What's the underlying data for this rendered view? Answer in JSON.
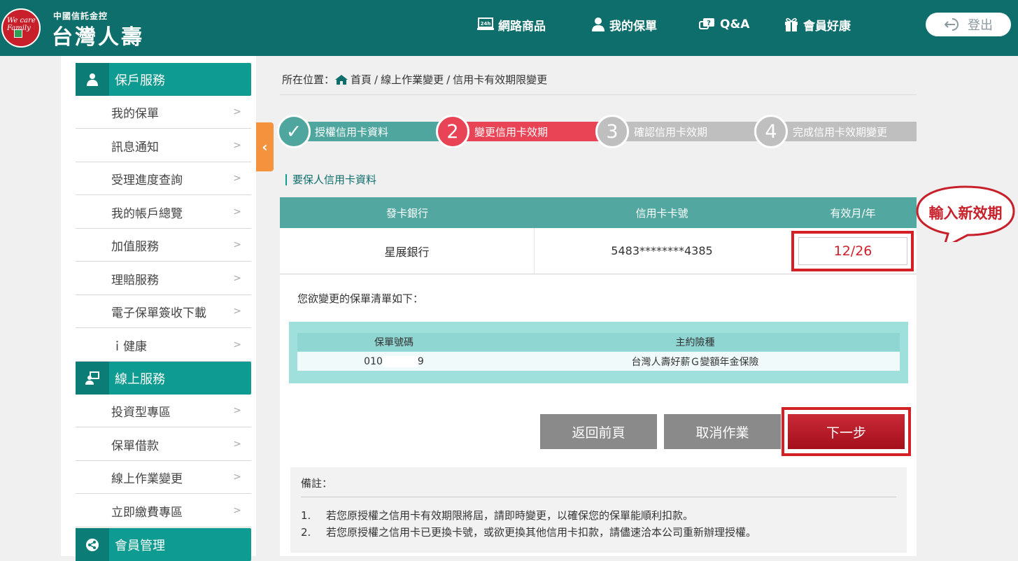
{
  "header": {
    "logo_text": "We care Family",
    "brand_small": "中國信託金控",
    "brand_big": "台灣人壽",
    "nav": [
      {
        "label": "網路商品",
        "icon": "laptop-24h-icon"
      },
      {
        "label": "我的保單",
        "icon": "user-icon"
      },
      {
        "label": "Q&A",
        "icon": "question-bubble-icon"
      },
      {
        "label": "會員好康",
        "icon": "gift-icon"
      }
    ],
    "logout_label": "登出"
  },
  "sidebar": {
    "sections": [
      {
        "title": "保戶服務",
        "icon": "user-icon",
        "items": [
          "我的保單",
          "訊息通知",
          "受理進度查詢",
          "我的帳戶總覽",
          "加值服務",
          "理賠服務",
          "電子保單簽收下載",
          "ｉ健康"
        ]
      },
      {
        "title": "線上服務",
        "icon": "online-service-icon",
        "items": [
          "投資型專區",
          "保單借款",
          "線上作業變更",
          "立即繳費專區"
        ]
      },
      {
        "title": "會員管理",
        "icon": "share-icon",
        "items": []
      }
    ]
  },
  "breadcrumb": {
    "prefix": "所在位置：",
    "items": [
      "首頁",
      "線上作業變更",
      "信用卡有效期限變更"
    ],
    "sep": "/"
  },
  "steps": [
    {
      "num": "✓",
      "label": "授權信用卡資料",
      "state": "done",
      "color": "#4ea69f"
    },
    {
      "num": "2",
      "label": "變更信用卡效期",
      "state": "active",
      "color": "#e84456"
    },
    {
      "num": "3",
      "label": "確認信用卡效期",
      "state": "pending",
      "color": "#bfbfbf"
    },
    {
      "num": "4",
      "label": "完成信用卡效期變更",
      "state": "pending",
      "color": "#bfbfbf"
    }
  ],
  "card_section": {
    "title": "要保人信用卡資料",
    "columns": [
      "發卡銀行",
      "信用卡卡號",
      "有效月/年"
    ],
    "row": {
      "bank": "星展銀行",
      "card_no": "5483********4385",
      "expiry": "12/26"
    }
  },
  "policy_section": {
    "intro": "您欲變更的保單清單如下：",
    "columns": [
      "保單號碼",
      "主約險種"
    ],
    "rows": [
      {
        "no_prefix": "010",
        "no_suffix": "9",
        "product": "台灣人壽好薪Ｇ變額年金保險"
      }
    ]
  },
  "buttons": {
    "back": "返回前頁",
    "cancel": "取消作業",
    "next": "下一步"
  },
  "notes": {
    "title": "備註：",
    "items": [
      "若您原授權之信用卡有效期限將屆，請即時變更，以確保您的保單能順利扣款。",
      "若您原授權之信用卡已更換卡號，或欲更換其他信用卡扣款，請儘速洽本公司重新辦理授權。"
    ]
  },
  "annotation": {
    "callout": "輸入新效期"
  },
  "colors": {
    "header": "#0e6e6b",
    "accent": "#0e9b92",
    "danger": "#d41f25",
    "toggle": "#f5923e"
  }
}
